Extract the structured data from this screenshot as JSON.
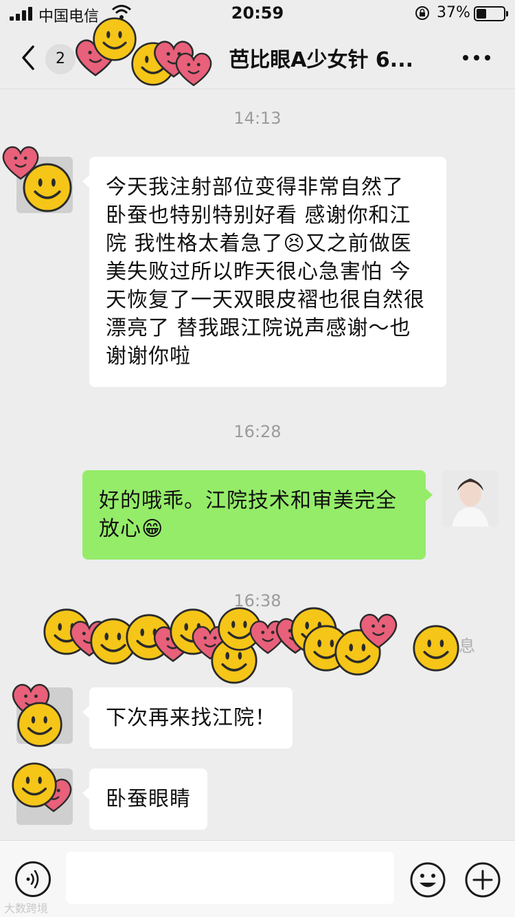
{
  "status_bar": {
    "carrier": "中国电信",
    "time": "20:59",
    "battery_percent": "37%",
    "battery_level": 0.37
  },
  "nav": {
    "unread_count": "2",
    "title": "芭比眼A少女针 6...",
    "back_icon": "chevron-left-icon",
    "more_icon": "more-dots-icon"
  },
  "chat": {
    "time_1": "14:13",
    "msg_1": "今天我注射部位变得非常自然了 卧蚕也特别特别好看 感谢你和江院 我性格太着急了😣又之前做医美失败过所以昨天很心急害怕 今天恢复了一天双眼皮褶也很自然很漂亮了 替我跟江院说声感谢～也谢谢你啦",
    "time_2": "16:28",
    "msg_2": "好的哦乖。江院技术和审美完全放心😁",
    "time_3": "16:38",
    "faint_notice_end": "息",
    "msg_3": "下次再来找江院！",
    "msg_4": "卧蚕眼睛"
  },
  "input_bar": {
    "voice_icon": "voice-icon",
    "emoji_icon": "emoji-icon",
    "plus_icon": "plus-icon"
  },
  "watermark": "大数跨境",
  "colors": {
    "background": "#ededed",
    "bubble_in": "#ffffff",
    "bubble_out": "#95ec69",
    "sticker_face": "#f5c518",
    "sticker_heart": "#e8607a"
  }
}
